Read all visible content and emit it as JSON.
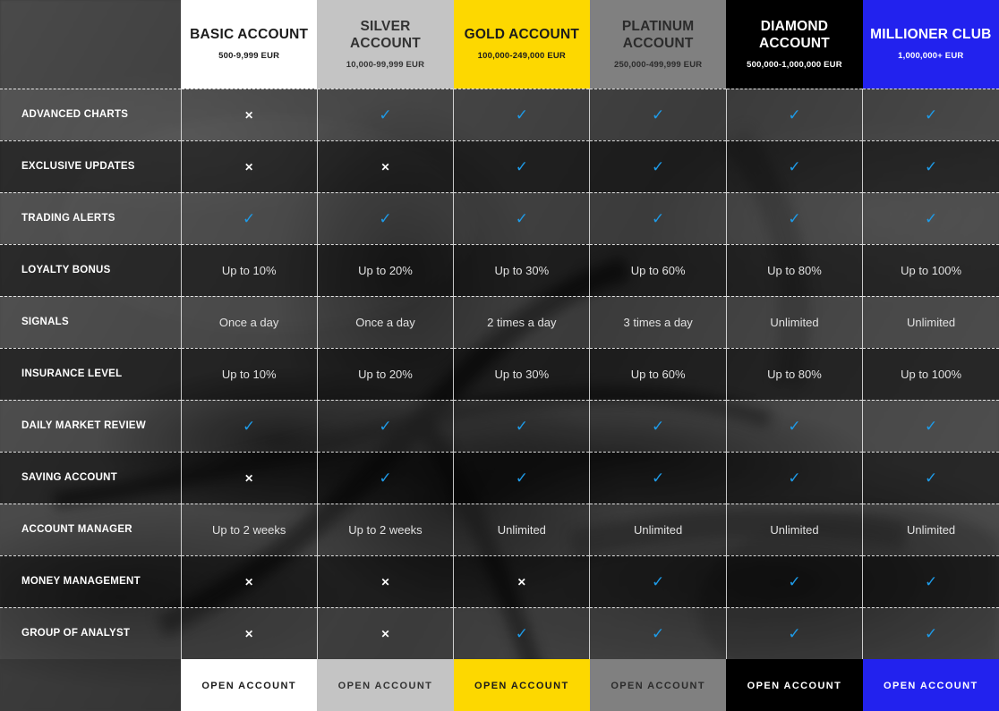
{
  "plans": [
    {
      "name": "BASIC ACCOUNT",
      "range": "500-9,999 EUR",
      "theme": "basic",
      "cta": "OPEN ACCOUNT"
    },
    {
      "name": "SILVER ACCOUNT",
      "range": "10,000-99,999 EUR",
      "theme": "silver",
      "cta": "OPEN ACCOUNT"
    },
    {
      "name": "GOLD ACCOUNT",
      "range": "100,000-249,000 EUR",
      "theme": "gold",
      "cta": "OPEN ACCOUNT"
    },
    {
      "name": "PLATINUM ACCOUNT",
      "range": "250,000-499,999 EUR",
      "theme": "platinum",
      "cta": "OPEN ACCOUNT"
    },
    {
      "name": "DIAMOND ACCOUNT",
      "range": "500,000-1,000,000 EUR",
      "theme": "diamond",
      "cta": "OPEN ACCOUNT"
    },
    {
      "name": "MILLIONER CLUB",
      "range": "1,000,000+ EUR",
      "theme": "millioner",
      "cta": "OPEN ACCOUNT"
    }
  ],
  "symbols": {
    "yes": "✓",
    "no": "✕",
    "yes_color": "#1e9be8",
    "no_color": "#ffffff"
  },
  "rows": [
    {
      "label": "ADVANCED CHARTS",
      "values": [
        "no",
        "yes",
        "yes",
        "yes",
        "yes",
        "yes"
      ]
    },
    {
      "label": "EXCLUSIVE UPDATES",
      "values": [
        "no",
        "no",
        "yes",
        "yes",
        "yes",
        "yes"
      ]
    },
    {
      "label": "TRADING ALERTS",
      "values": [
        "yes",
        "yes",
        "yes",
        "yes",
        "yes",
        "yes"
      ]
    },
    {
      "label": "LOYALTY BONUS",
      "values": [
        "Up to 10%",
        "Up to 20%",
        "Up to 30%",
        "Up to 60%",
        "Up to 80%",
        "Up to 100%"
      ]
    },
    {
      "label": "SIGNALS",
      "values": [
        "Once a day",
        "Once a day",
        "2 times a day",
        "3 times a day",
        "Unlimited",
        "Unlimited"
      ]
    },
    {
      "label": "INSURANCE LEVEL",
      "values": [
        "Up to 10%",
        "Up to 20%",
        "Up to 30%",
        "Up to 60%",
        "Up to 80%",
        "Up to 100%"
      ]
    },
    {
      "label": "DAILY MARKET REVIEW",
      "values": [
        "yes",
        "yes",
        "yes",
        "yes",
        "yes",
        "yes"
      ]
    },
    {
      "label": "SAVING ACCOUNT",
      "values": [
        "no",
        "yes",
        "yes",
        "yes",
        "yes",
        "yes"
      ]
    },
    {
      "label": "ACCOUNT MANAGER",
      "values": [
        "Up to 2 weeks",
        "Up to 2 weeks",
        "Unlimited",
        "Unlimited",
        "Unlimited",
        "Unlimited"
      ]
    },
    {
      "label": "MONEY MANAGEMENT",
      "values": [
        "no",
        "no",
        "no",
        "yes",
        "yes",
        "yes"
      ]
    },
    {
      "label": "GROUP OF ANALYST",
      "values": [
        "no",
        "no",
        "yes",
        "yes",
        "yes",
        "yes"
      ]
    }
  ]
}
